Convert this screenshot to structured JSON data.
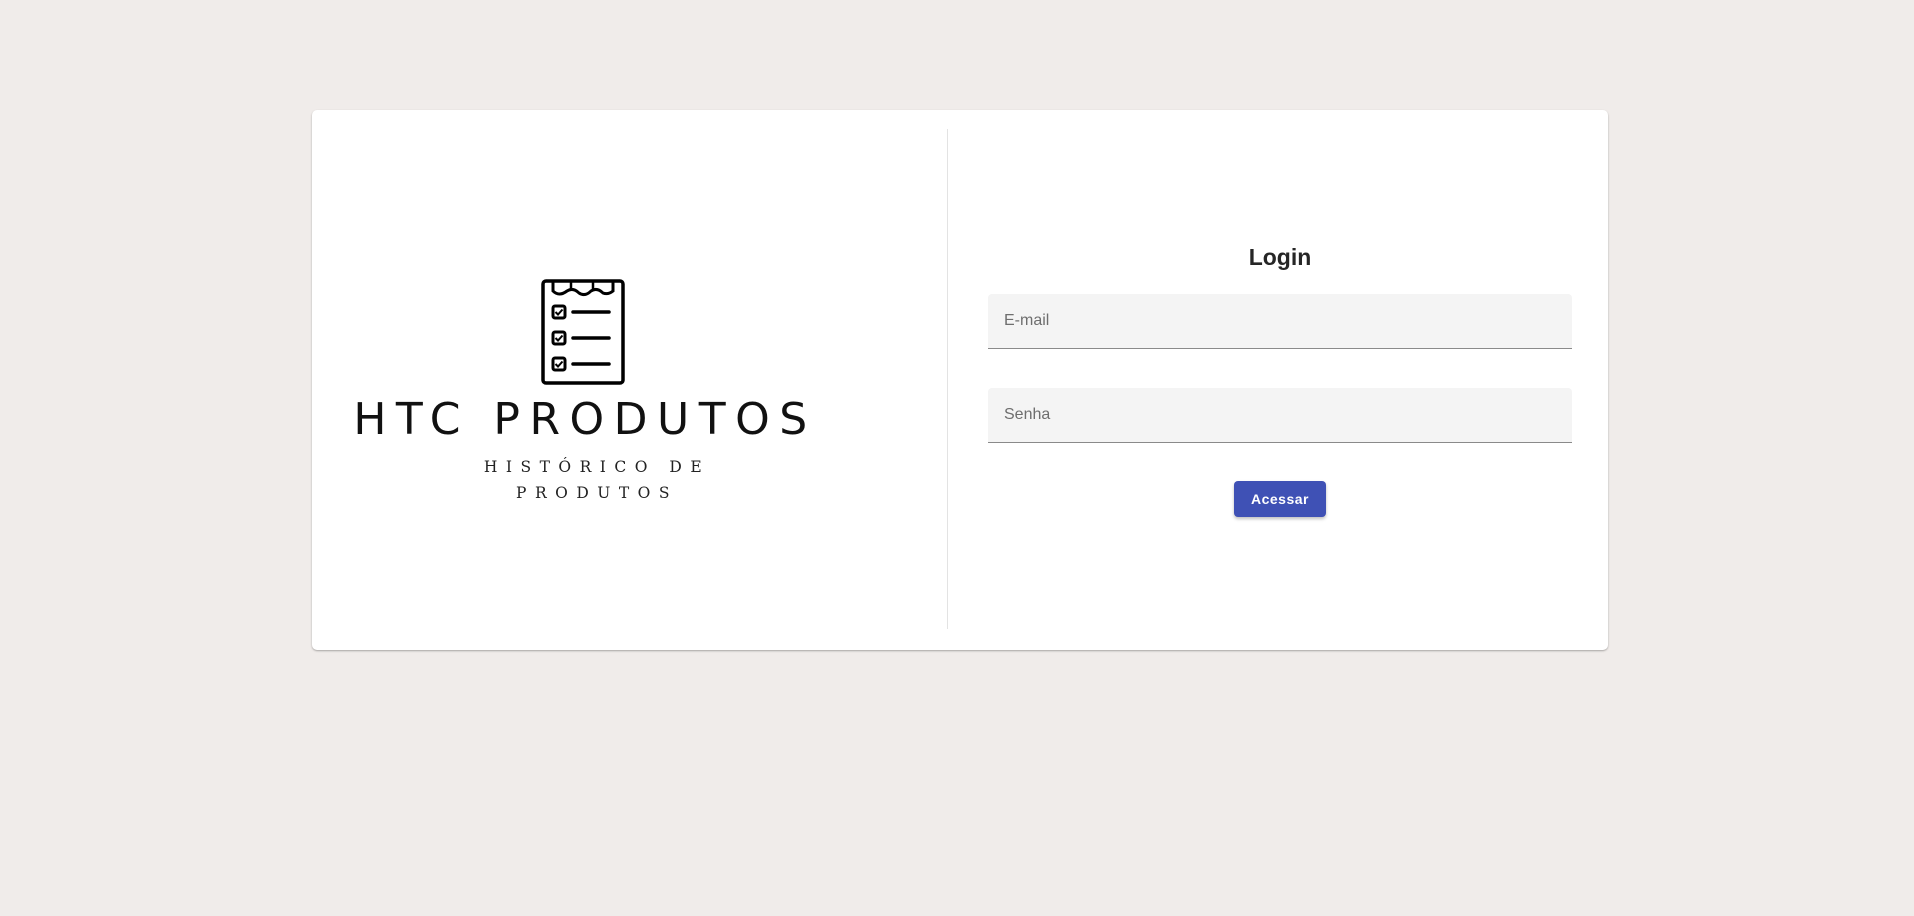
{
  "brand": {
    "title": "HTC PRODUTOS",
    "subtitle": "HISTÓRICO DE PRODUTOS",
    "icon": "clipboard-checklist-icon"
  },
  "login": {
    "title": "Login",
    "email": {
      "placeholder": "E-mail",
      "value": ""
    },
    "password": {
      "placeholder": "Senha",
      "value": ""
    },
    "submit_label": "Acessar"
  },
  "colors": {
    "background": "#f0ecea",
    "card": "#ffffff",
    "primary": "#3f51b5",
    "field_background": "#f4f4f4"
  }
}
